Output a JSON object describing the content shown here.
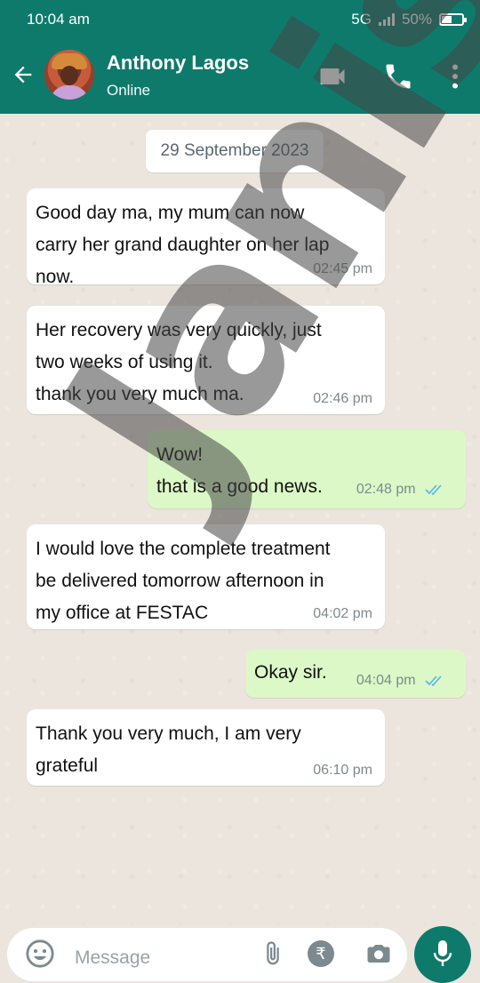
{
  "status_bar": {
    "time": "10:04 am",
    "network": "5G",
    "battery_percent": "50%",
    "battery_level": 0.5
  },
  "header": {
    "contact_name": "Anthony Lagos",
    "contact_status": "Online",
    "icons": [
      "back-arrow-icon",
      "video-call-icon",
      "phone-icon",
      "more-vert-icon"
    ]
  },
  "chat": {
    "date": "29 September 2023",
    "messages": [
      {
        "direction": "in",
        "text": " Good day ma, my mum can now\ncarry her grand daughter on her lap\nnow.",
        "time": "02:45 pm"
      },
      {
        "direction": "in",
        "text": " Her recovery was very quickly, just\ntwo weeks of using it.\nthank you very much ma.",
        "time": "02:46 pm"
      },
      {
        "direction": "out",
        "text": "Wow!\nthat is a good news.",
        "time": "02:48 pm",
        "read": true
      },
      {
        "direction": "in",
        "text": " I would love the complete treatment\nbe delivered tomorrow afternoon in\nmy office at FESTAC",
        "time": "04:02 pm"
      },
      {
        "direction": "out",
        "text": "Okay sir.",
        "time": "04:04 pm",
        "read": true
      },
      {
        "direction": "in",
        "text": " Thank you very much, I am very\ngrateful",
        "time": "06:10 pm"
      }
    ]
  },
  "watermark": "Janis",
  "input": {
    "placeholder": "Message",
    "rupee_symbol": "₹"
  },
  "colors": {
    "header": "#0e7a6c",
    "outgoing_bubble": "#dcf8c6",
    "incoming_bubble": "#ffffff",
    "read_ticks": "#4fb6ec"
  }
}
